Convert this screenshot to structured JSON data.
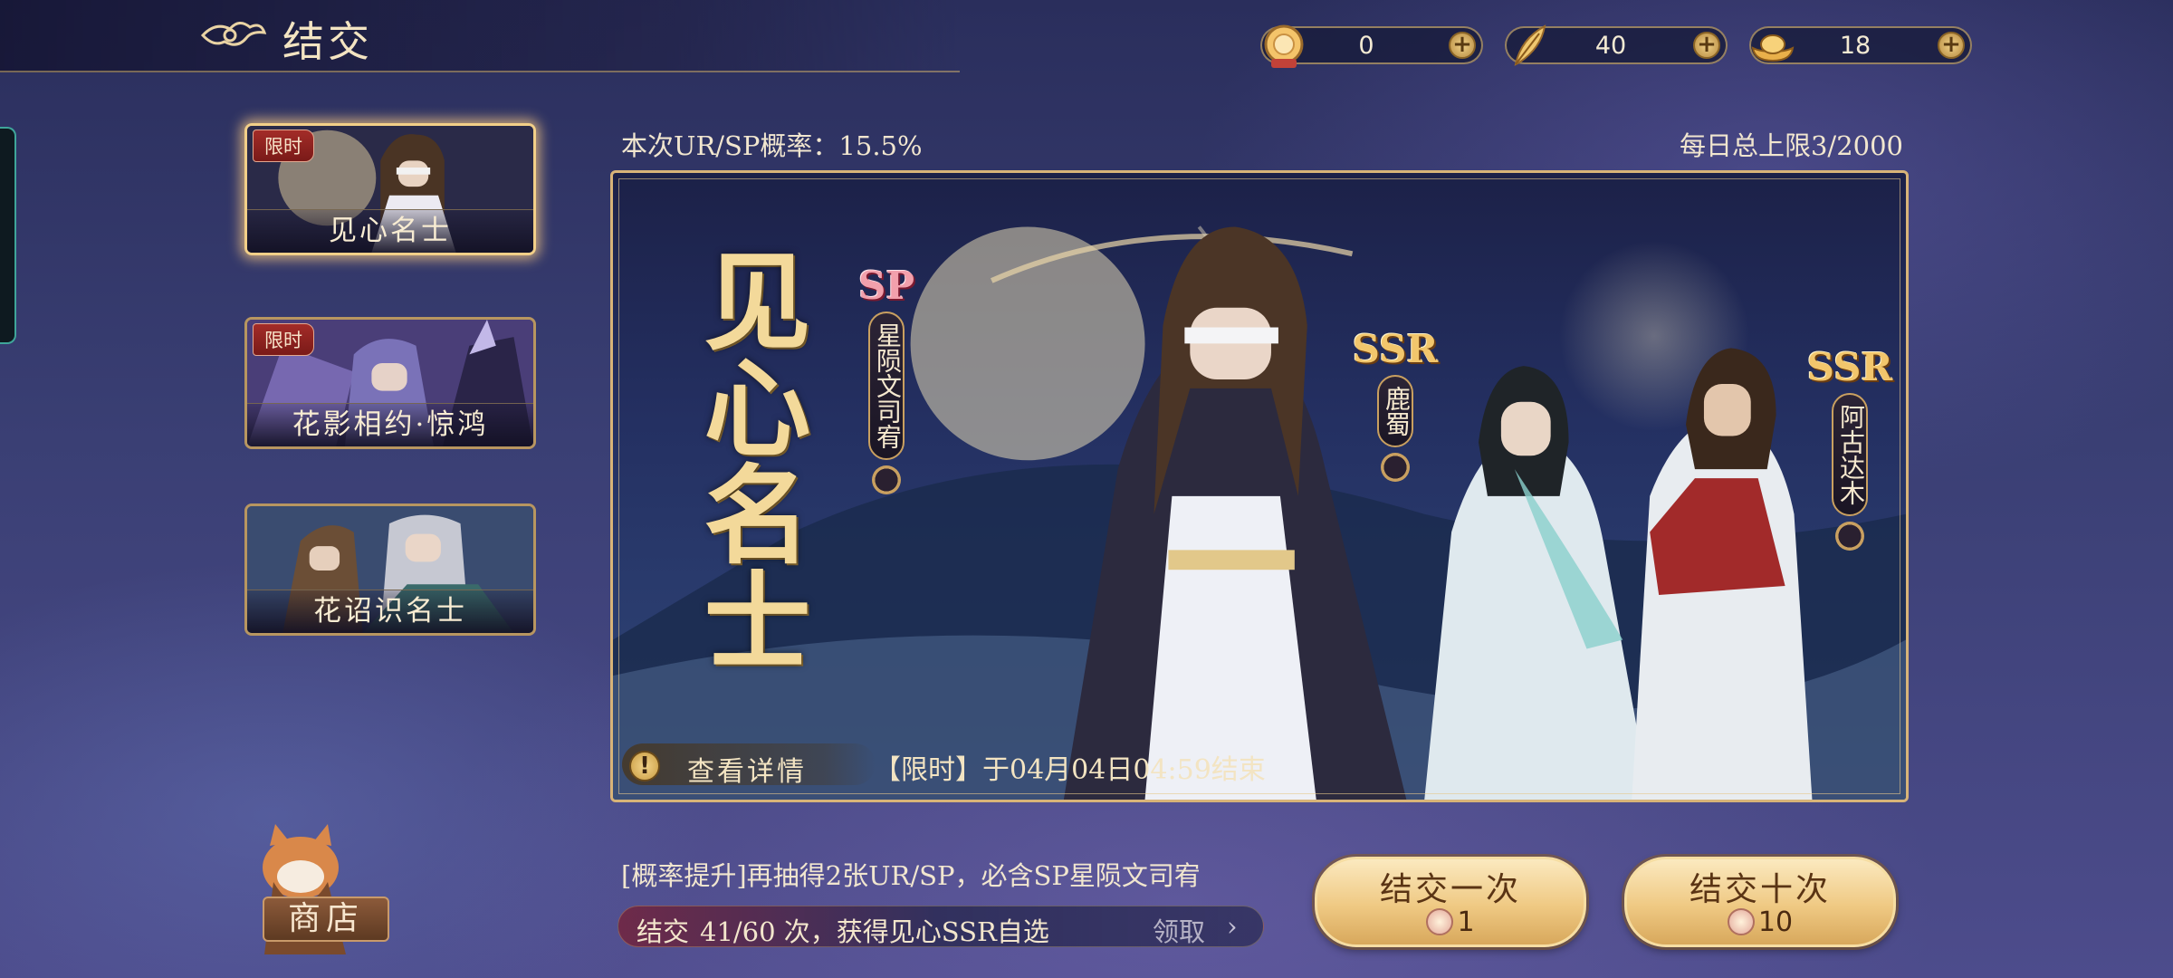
{
  "header": {
    "title": "结交",
    "currencies": [
      {
        "name": "token-icon",
        "value": "0",
        "color": "#f4c46a"
      },
      {
        "name": "feather-icon",
        "value": "40",
        "color": "#f0c870"
      },
      {
        "name": "gold-ingot-icon",
        "value": "18",
        "color": "#f5c65a"
      }
    ]
  },
  "banners": [
    {
      "tag": "限时",
      "label": "见心名士",
      "active": true
    },
    {
      "tag": "限时",
      "label": "花影相约·惊鸿",
      "active": false
    },
    {
      "tag": "",
      "label": "花诏识名士",
      "active": false
    }
  ],
  "info": {
    "rate": "本次UR/SP概率：15.5%",
    "daily_limit": "每日总上限3/2000"
  },
  "main_banner": {
    "title": "见心名士",
    "characters": [
      {
        "rarity": "SP",
        "name": "星陨文司宥"
      },
      {
        "rarity": "SSR",
        "name": "鹿蜀"
      },
      {
        "rarity": "SSR",
        "name": "阿古达木"
      }
    ],
    "details_label": "查看详情",
    "end_text": "【限时】于04月04日04:59结束"
  },
  "bottom": {
    "shop_label": "商店",
    "boost_text": "[概率提升]再抽得2张UR/SP，必含SP星陨文司宥",
    "progress": {
      "label": "结交",
      "count_text": "41/60 次，获得见心SSR自选",
      "current": 41,
      "total": 60,
      "claim": "领取",
      "arrow": "›"
    },
    "pull_once": {
      "label": "结交一次",
      "cost": "1"
    },
    "pull_ten": {
      "label": "结交十次",
      "cost": "10"
    }
  }
}
